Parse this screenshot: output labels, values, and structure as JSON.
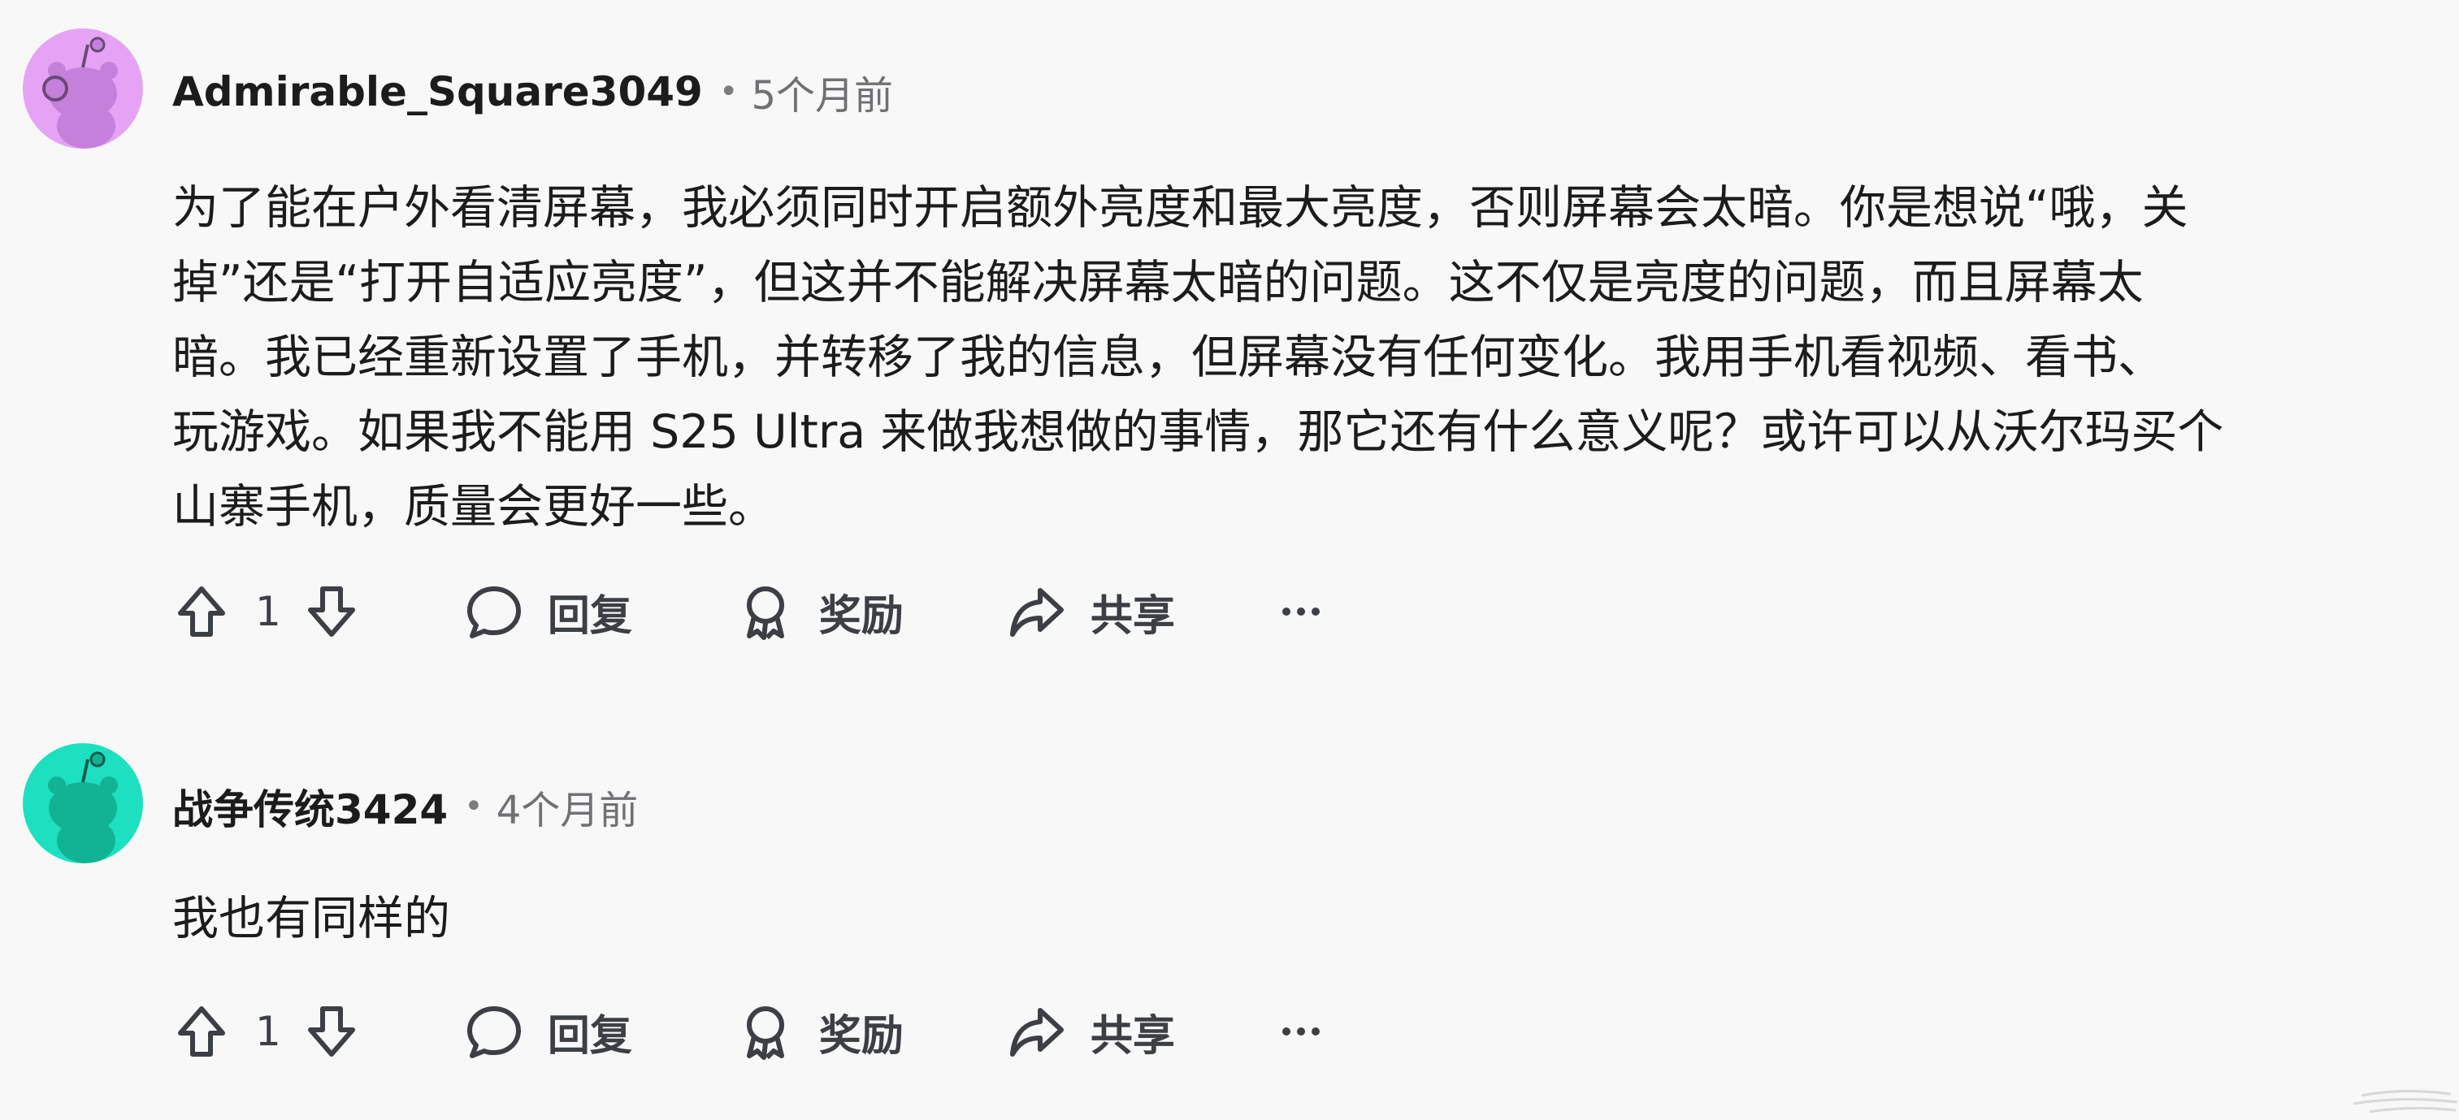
{
  "comments": [
    {
      "username": "Admirable_Square3049",
      "separator": "•",
      "time": "5个月前",
      "avatar_bg": "#e6a3f5",
      "avatar_fg": "#c580dc",
      "body_lines": [
        "为了能在户外看清屏幕，我必须同时开启额外亮度和最大亮度，否则屏幕会太暗。你是想说“哦，关",
        "掉”还是“打开自适应亮度”，但这并不能解决屏幕太暗的问题。这不仅是亮度的问题，而且屏幕太",
        "暗。我已经重新设置了手机，并转移了我的信息，但屏幕没有任何变化。我用手机看视频、看书、",
        "玩游戏。如果我不能用 S25 Ultra 来做我想做的事情，那它还有什么意义呢？或许可以从沃尔玛买个",
        "山寨手机，质量会更好一些。"
      ],
      "vote_count": "1",
      "reply_label": "回复",
      "award_label": "奖励",
      "share_label": "共享"
    },
    {
      "username": "战争传统3424",
      "separator": "•",
      "time": "4个月前",
      "avatar_bg": "#1de0c0",
      "avatar_fg": "#12b395",
      "body_lines": [
        "我也有同样的"
      ],
      "vote_count": "1",
      "reply_label": "回复",
      "award_label": "奖励",
      "share_label": "共享"
    }
  ]
}
